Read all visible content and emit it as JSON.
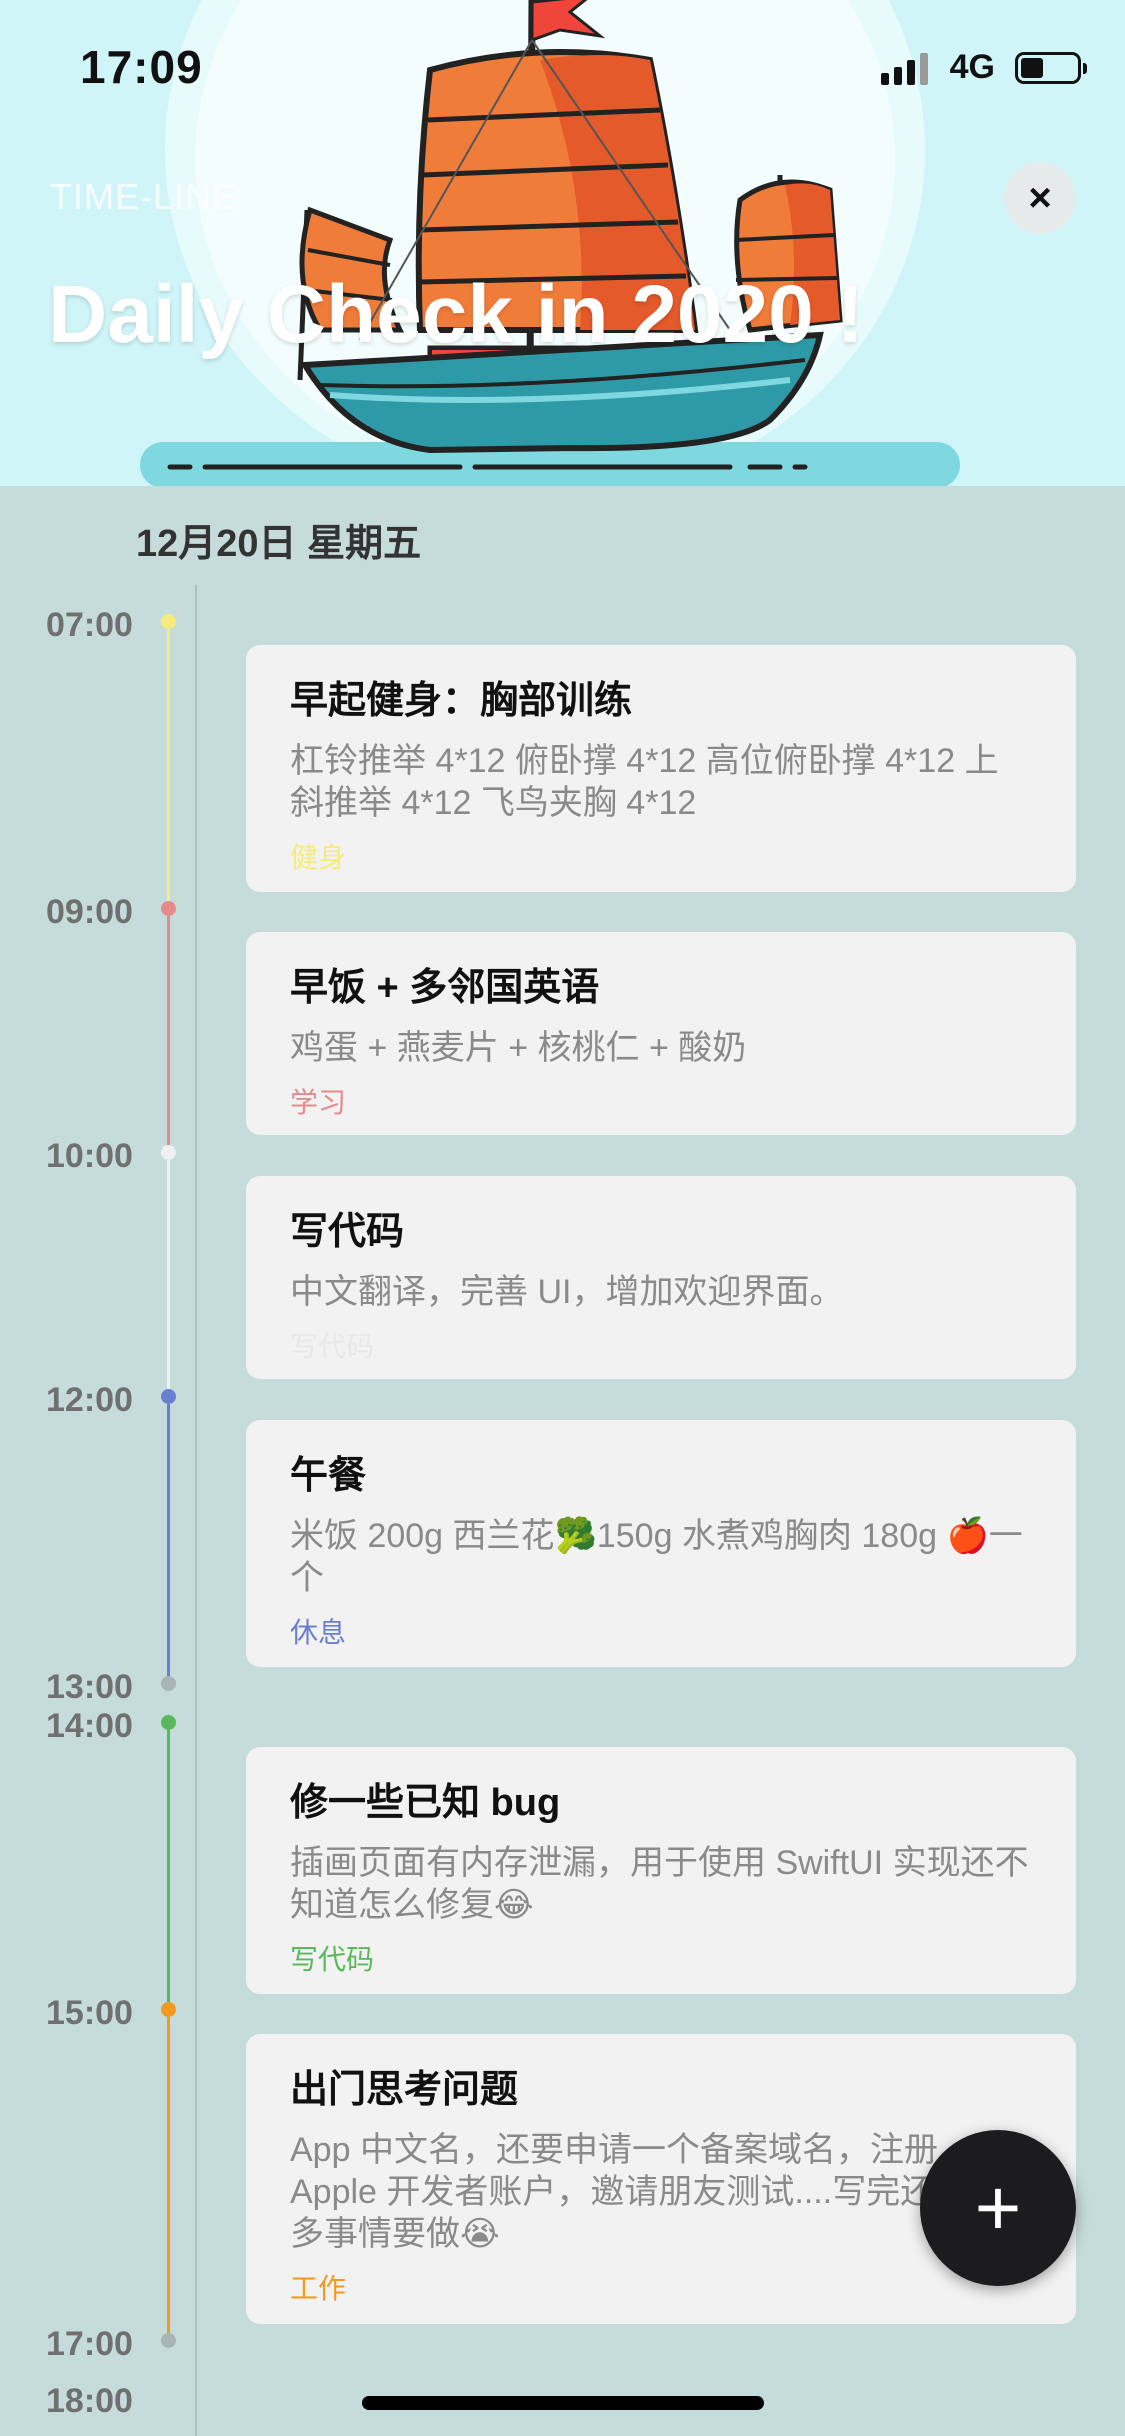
{
  "status_bar": {
    "time": "17:09",
    "network": "4G"
  },
  "header": {
    "subtitle": "TIME-LINE",
    "title": "Daily Check in 2020 !",
    "close_icon": "×"
  },
  "date": "12月20日 星期五",
  "colors": {
    "fitness": "#f5ec7a",
    "study": "#e58a8a",
    "code_grey": "#e8e8e8",
    "rest": "#6a7ed0",
    "code_green": "#5bb85a",
    "work": "#f29a1e"
  },
  "timeline": {
    "times": [
      "07:00",
      "09:00",
      "10:00",
      "12:00",
      "13:00",
      "14:00",
      "15:00",
      "17:00",
      "18:00"
    ]
  },
  "events": [
    {
      "title": "早起健身：胸部训练",
      "desc": "杠铃推举 4*12 俯卧撑 4*12 高位俯卧撑 4*12 上斜推举 4*12 飞鸟夹胸 4*12",
      "tag": "健身"
    },
    {
      "title": "早饭 + 多邻国英语",
      "desc": "鸡蛋 + 燕麦片 + 核桃仁 + 酸奶",
      "tag": "学习"
    },
    {
      "title": "写代码",
      "desc": "中文翻译，完善 UI，增加欢迎界面。",
      "tag": "写代码"
    },
    {
      "title": "午餐",
      "desc": "米饭 200g 西兰花🥦150g 水煮鸡胸肉 180g 🍎一个",
      "tag": "休息"
    },
    {
      "title": "修一些已知 bug",
      "desc": "插画页面有内存泄漏，用于使用 SwiftUI 实现还不知道怎么修复😂",
      "tag": "写代码"
    },
    {
      "title": "出门思考问题",
      "desc": "App 中文名，还要申请一个备案域名，注册 Apple 开发者账户，邀请朋友测试....写完还有好多事情要做😭",
      "tag": "工作"
    }
  ],
  "fab": {
    "icon": "+"
  }
}
